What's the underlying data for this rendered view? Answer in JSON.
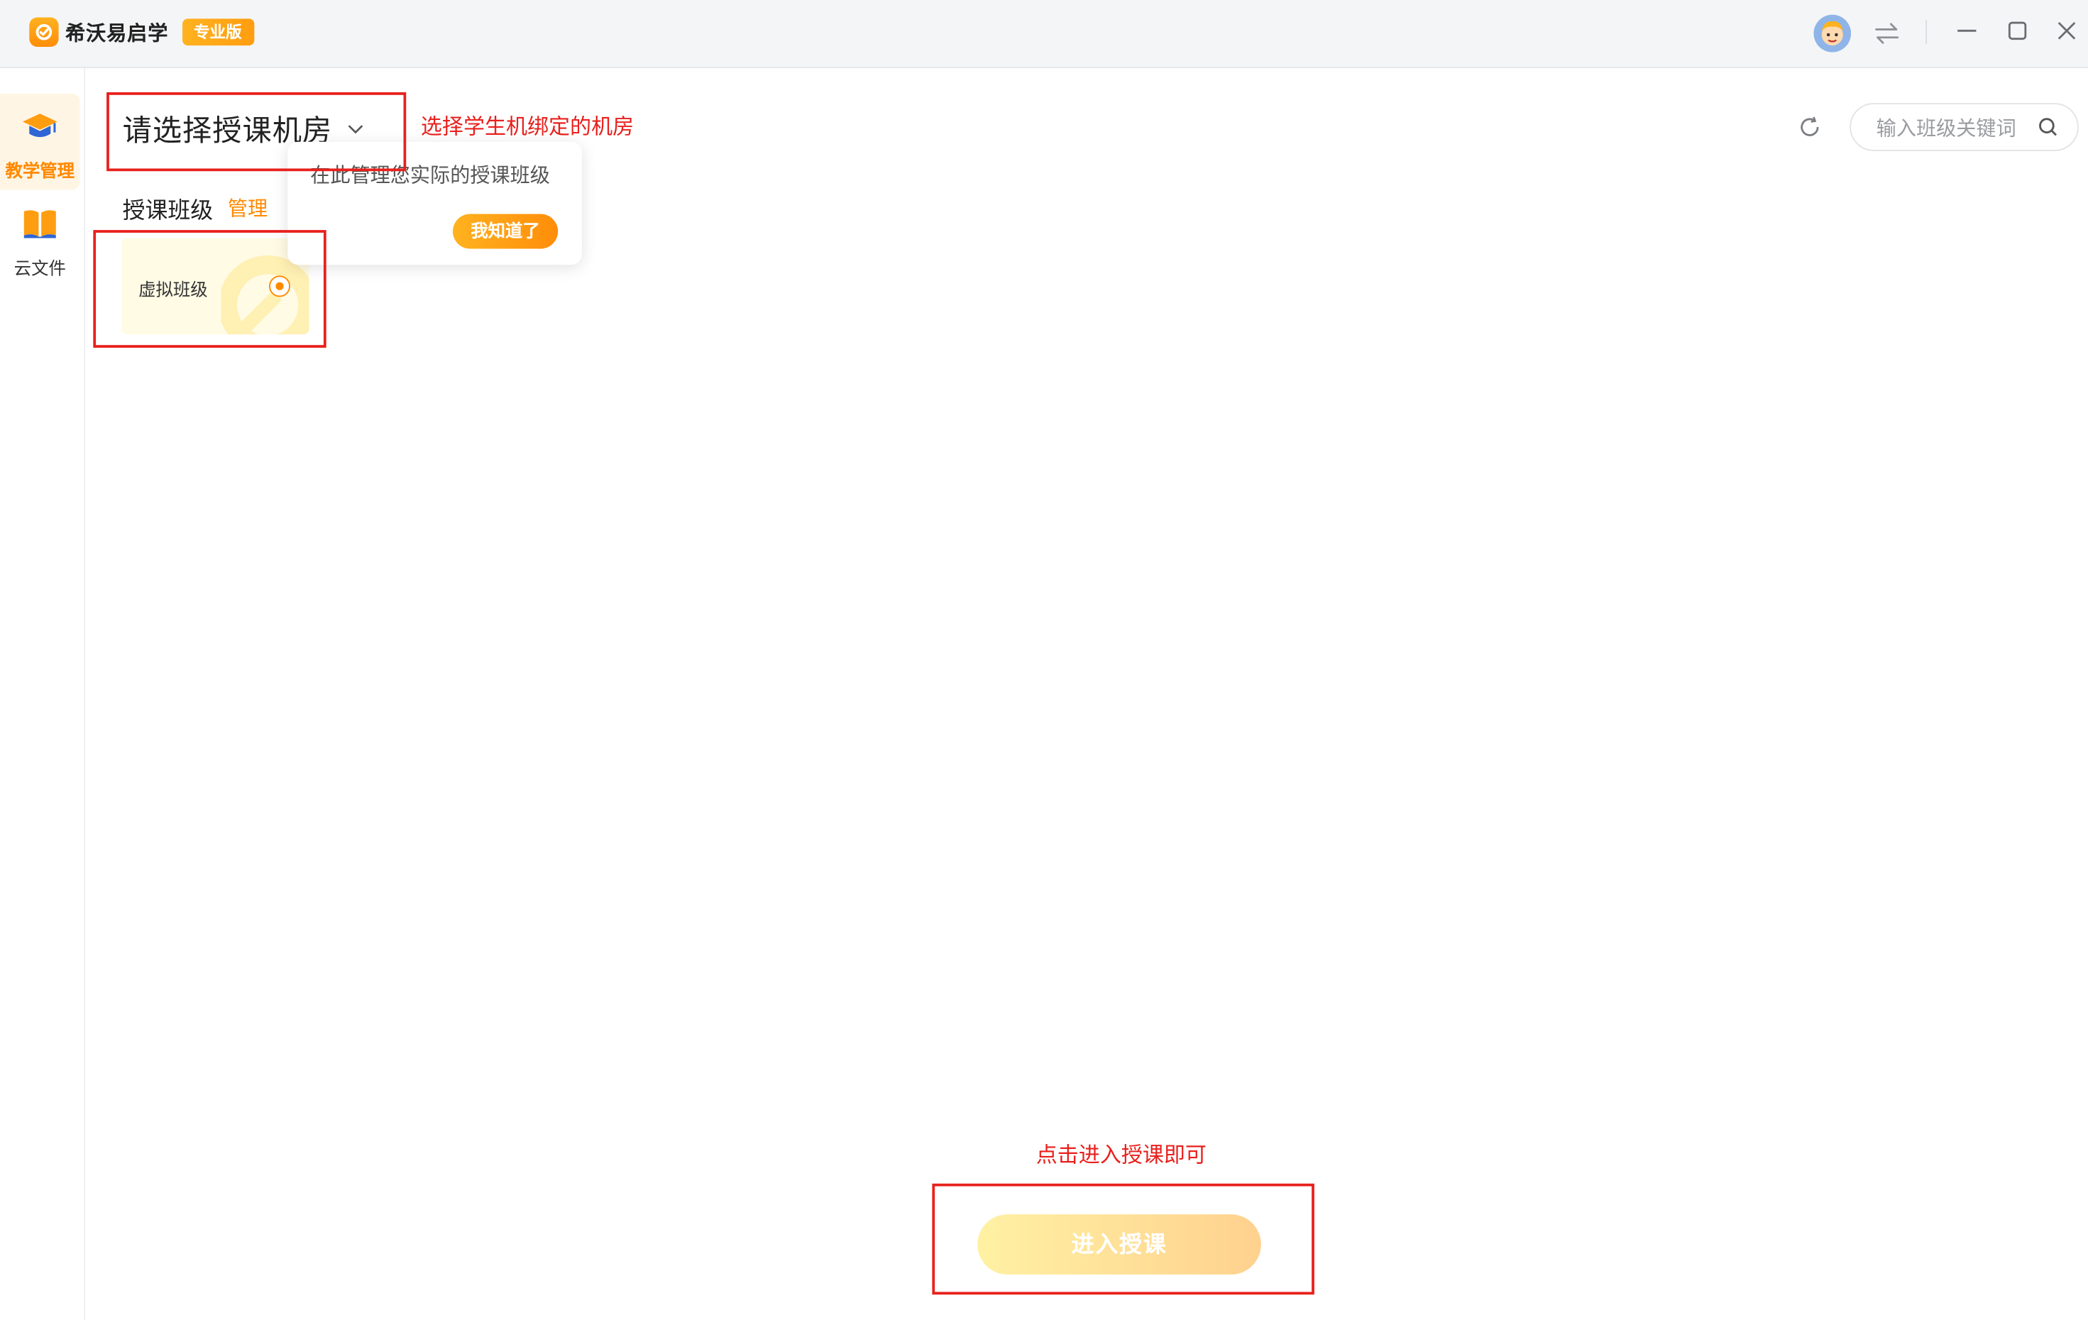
{
  "app": {
    "name": "希沃易启学",
    "edition": "专业版"
  },
  "sidebar": {
    "items": [
      {
        "label": "教学管理",
        "icon": "graduation-cap-icon",
        "active": true
      },
      {
        "label": "云文件",
        "icon": "open-book-icon",
        "active": false
      }
    ],
    "settings_icon": "gear-icon"
  },
  "main": {
    "room_select": {
      "label": "请选择授课机房",
      "icon": "chevron-down-icon"
    },
    "section": {
      "title": "授课班级",
      "manage": "管理"
    },
    "classes": [
      {
        "name": "虚拟班级",
        "selected": true
      }
    ],
    "tooltip": {
      "message": "在此管理您实际的授课班级",
      "confirm": "我知道了"
    },
    "search": {
      "placeholder": "输入班级关键词",
      "value": ""
    },
    "enter_button": "进入授课"
  },
  "annotations": {
    "room_hint": "选择学生机绑定的机房",
    "enter_hint": "点击进入授课即可"
  },
  "colors": {
    "accent": "#ff8a00",
    "annotation": "#e8201c",
    "card_bg": "#fffbe5"
  }
}
